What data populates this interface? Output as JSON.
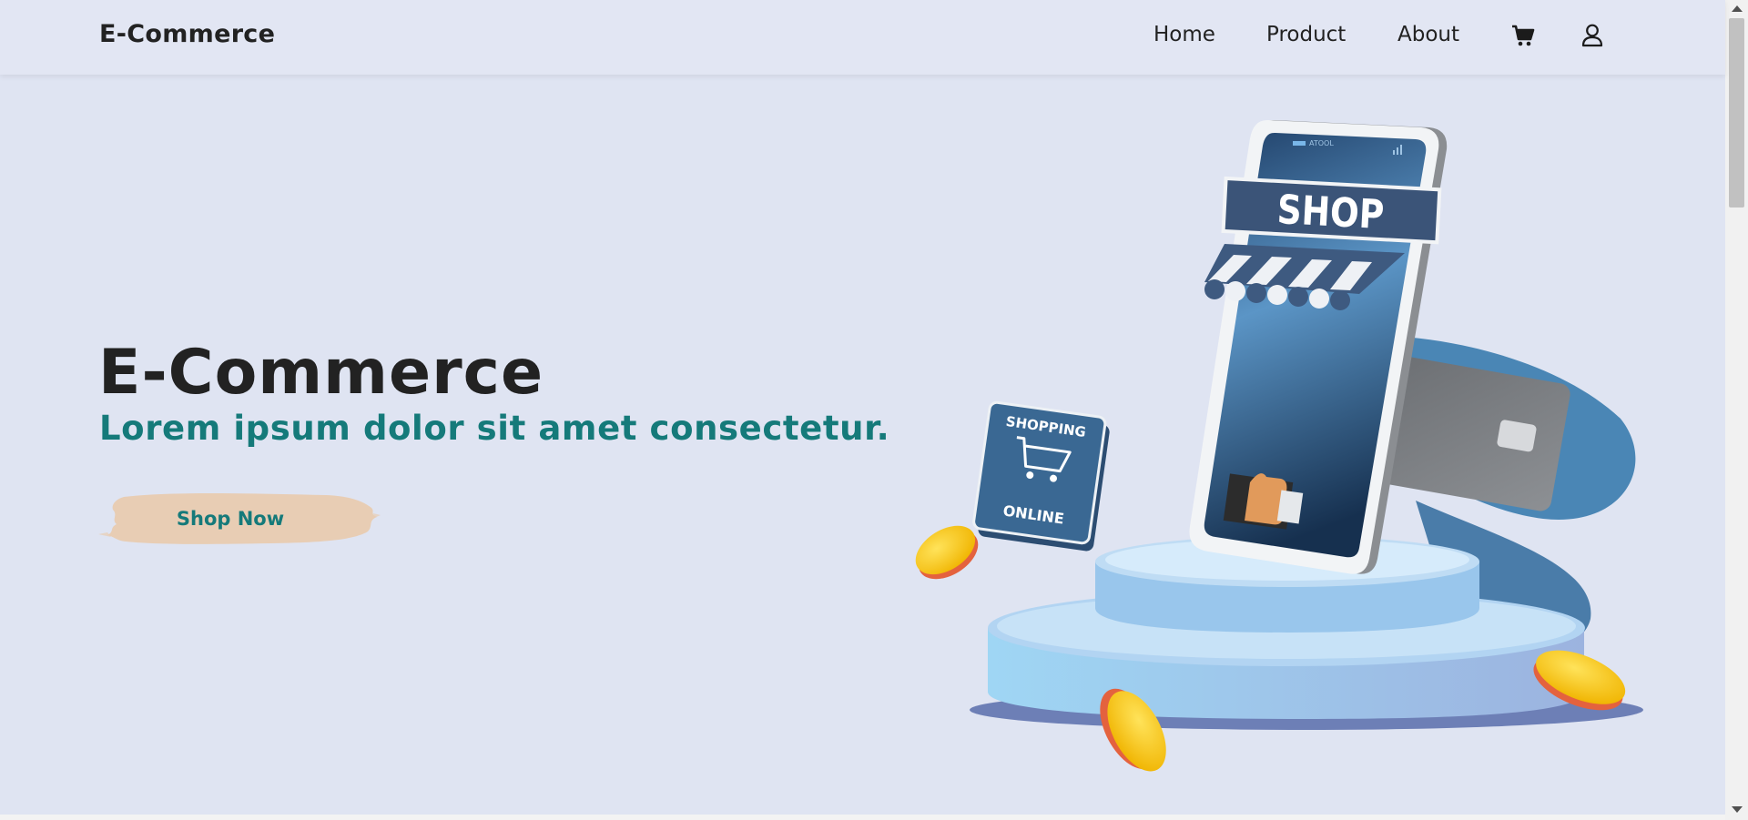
{
  "navbar": {
    "brand": "E-Commerce",
    "links": [
      "Home",
      "Product",
      "About"
    ],
    "icons": [
      "cart-icon",
      "user-icon"
    ]
  },
  "hero": {
    "title": "E-Commerce",
    "subtitle": "Lorem ipsum dolor sit amet consectetur.",
    "button_label": "Shop Now",
    "button_color": "#e8cdb4",
    "accent_color": "#157a7a"
  },
  "illustration": {
    "shop_sign": "SHOP",
    "badge_top": "SHOPPING",
    "badge_bottom": "ONLINE",
    "phone_status": "ATOOL"
  }
}
